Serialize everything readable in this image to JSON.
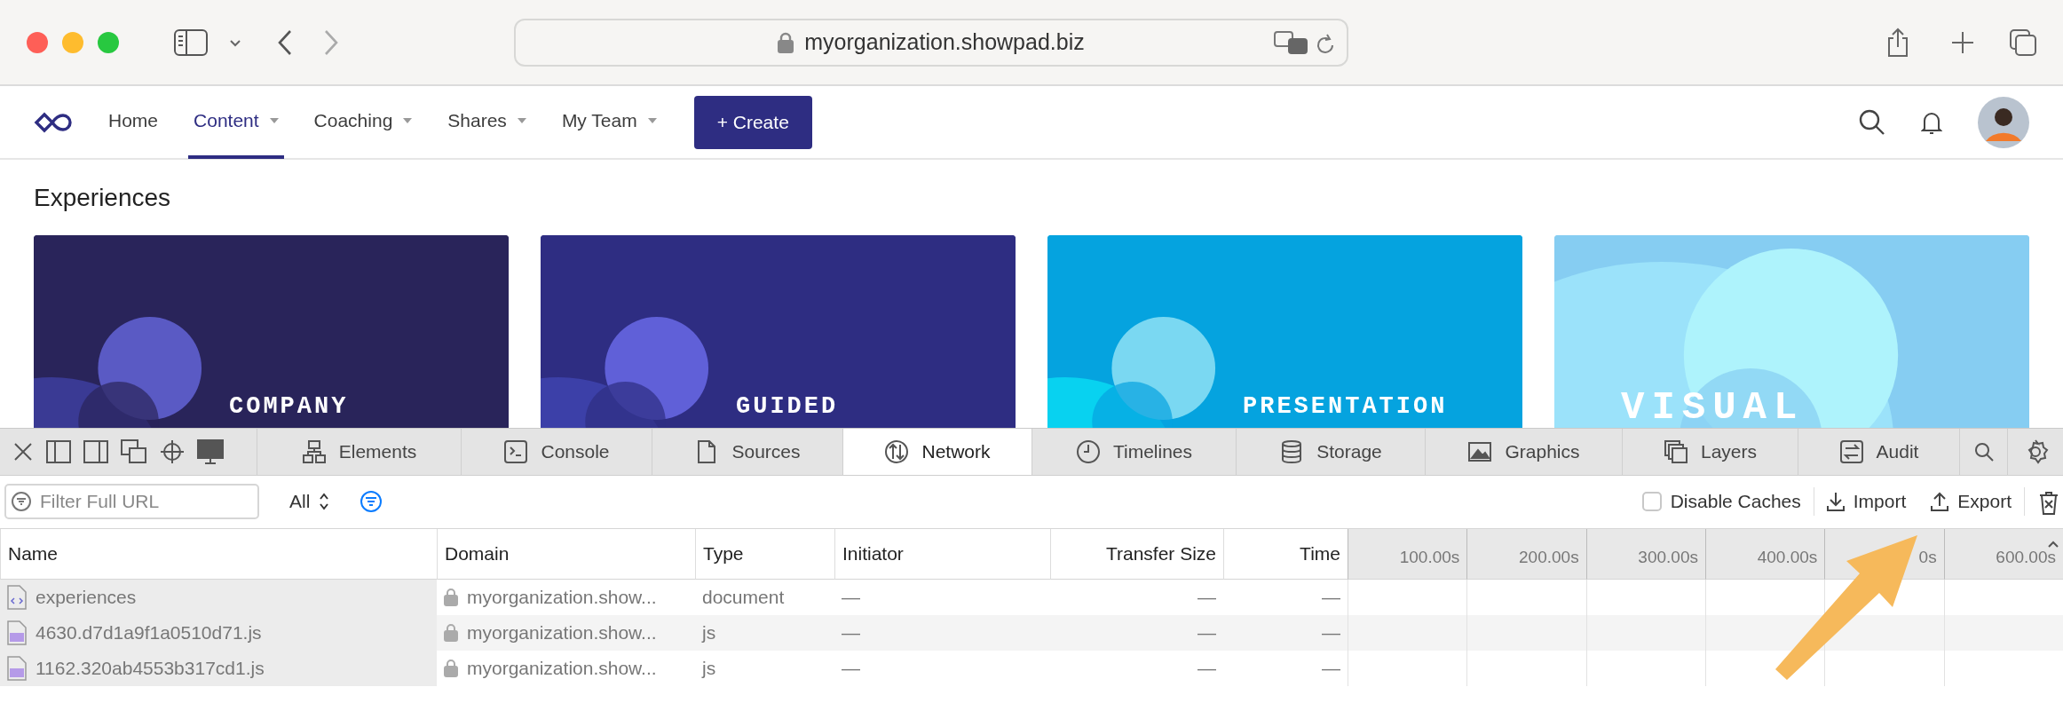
{
  "browser": {
    "url": "myorganization.showpad.biz"
  },
  "nav": {
    "items": [
      {
        "label": "Home",
        "selected": false,
        "dropdown": false
      },
      {
        "label": "Content",
        "selected": true,
        "dropdown": true
      },
      {
        "label": "Coaching",
        "selected": false,
        "dropdown": true
      },
      {
        "label": "Shares",
        "selected": false,
        "dropdown": true
      },
      {
        "label": "My Team",
        "selected": false,
        "dropdown": true
      }
    ],
    "create_button": "+ Create"
  },
  "heading": "Experiences",
  "cards": [
    {
      "title": "COMPANY",
      "color": "#29245a"
    },
    {
      "title": "GUIDED",
      "color": "#2e2d82"
    },
    {
      "title": "PRESENTATION",
      "color": "#05a3df"
    },
    {
      "title": "VISUAL",
      "color": "#86cdf2"
    }
  ],
  "devtools": {
    "tabs": [
      {
        "label": "Elements",
        "selected": false
      },
      {
        "label": "Console",
        "selected": false
      },
      {
        "label": "Sources",
        "selected": false
      },
      {
        "label": "Network",
        "selected": true
      },
      {
        "label": "Timelines",
        "selected": false
      },
      {
        "label": "Storage",
        "selected": false
      },
      {
        "label": "Graphics",
        "selected": false
      },
      {
        "label": "Layers",
        "selected": false
      },
      {
        "label": "Audit",
        "selected": false
      }
    ],
    "filter": {
      "placeholder": "Filter Full URL"
    },
    "type_filter": "All",
    "disable_caches": {
      "label": "Disable Caches",
      "checked": false
    },
    "import_button": "Import",
    "export_button": "Export",
    "table": {
      "columns": [
        "Name",
        "Domain",
        "Type",
        "Initiator",
        "Transfer Size",
        "Time"
      ],
      "ticks": [
        "100.00s",
        "200.00s",
        "300.00s",
        "400.00s",
        "0s",
        "600.00s"
      ],
      "rows": [
        {
          "kind": "document",
          "name": "experiences",
          "domain": "myorganization.show...",
          "type": "document",
          "initiator": "—",
          "transfer_size": "—",
          "time": "—"
        },
        {
          "kind": "script",
          "name": "4630.d7d1a9f1a0510d71.js",
          "domain": "myorganization.show...",
          "type": "js",
          "initiator": "—",
          "transfer_size": "—",
          "time": "—"
        },
        {
          "kind": "script",
          "name": "1162.320ab4553b317cd1.js",
          "domain": "myorganization.show...",
          "type": "js",
          "initiator": "—",
          "transfer_size": "—",
          "time": "—"
        }
      ]
    }
  }
}
